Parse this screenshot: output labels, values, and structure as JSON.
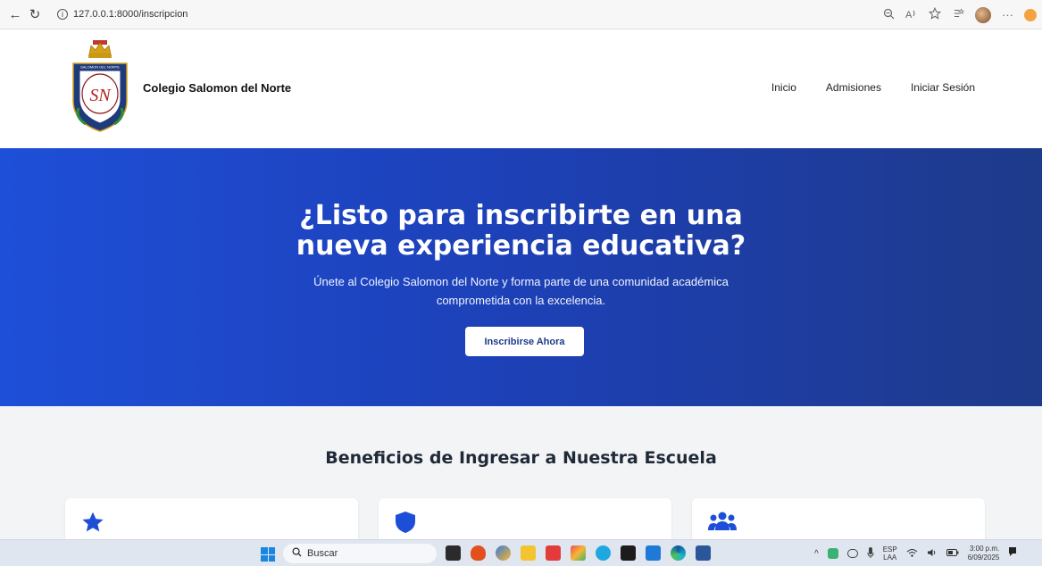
{
  "browser": {
    "url": "127.0.0.1:8000/inscripcion",
    "info_glyph": "i"
  },
  "header": {
    "logo_text": "SN",
    "logo_ring_text": "SALOMON DEL NORTE",
    "brand": "Colegio Salomon del Norte",
    "nav": [
      "Inicio",
      "Admisiones",
      "Iniciar Sesión"
    ]
  },
  "hero": {
    "title_line1": "¿Listo para inscribirte en una",
    "title_line2": "nueva experiencia educativa?",
    "subtitle_line1": "Únete al Colegio Salomon del Norte y forma parte de una comunidad académica",
    "subtitle_line2": "comprometida con la excelencia.",
    "cta": "Inscribirse Ahora"
  },
  "benefits": {
    "title": "Beneficios de Ingresar a Nuestra Escuela",
    "cards": [
      {
        "icon": "star-icon"
      },
      {
        "icon": "shield-icon"
      },
      {
        "icon": "users-icon"
      }
    ]
  },
  "taskbar": {
    "search_placeholder": "Buscar",
    "lang_top": "ESP",
    "lang_bottom": "LAA",
    "time": "3:00 p.m.",
    "date": "6/09/2025"
  },
  "colors": {
    "hero_start": "#1e4fd8",
    "hero_end": "#1e3a8a",
    "icon_blue": "#1d4ed8"
  }
}
